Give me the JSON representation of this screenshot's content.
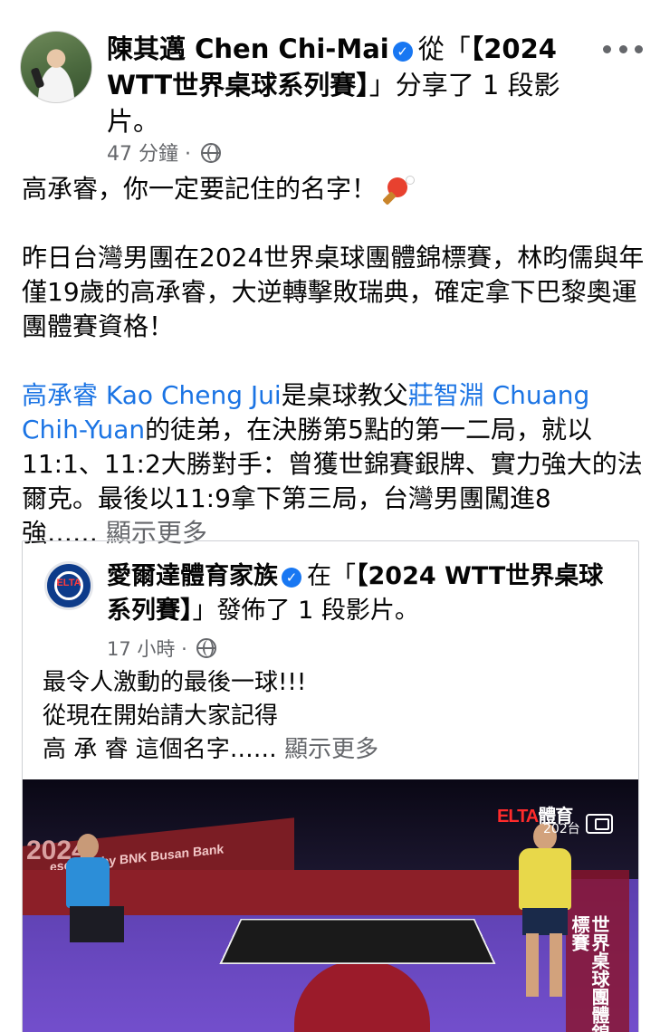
{
  "post": {
    "author": "陳其邁 Chen Chi-Mai",
    "action_prefix": "從「",
    "page_name": "【2024 WTT世界桌球系列賽】",
    "action_suffix": "」分享了 1 段影片。",
    "time": "47 分鐘",
    "privacy_icon": "globe-icon",
    "more_icon": "more-options-icon",
    "line1": "高承睿，你一定要記住的名字！",
    "paragraph2": "昨日台灣男團在2024世界桌球團體錦標賽，林昀儒與年僅19歲的高承睿，大逆轉擊敗瑞典，確定拿下巴黎奧運團體賽資格！",
    "p3_link1": "高承睿 Kao Cheng Jui",
    "p3_text1": "是桌球教父",
    "p3_link2": "莊智淵  Chuang Chih-Yuan",
    "p3_text2": "的徒弟，在決勝第5點的第一二局，就以11:1、11:2大勝對手：曾獲世錦賽銀牌、實力強大的法爾克。最後以11:9拿下第三局，台灣男團闖進8強……",
    "see_more": "顯示更多"
  },
  "shared": {
    "author": "愛爾達體育家族",
    "action_prefix": "在「",
    "page_name": "【2024 WTT世界桌球系列賽】",
    "action_suffix": "」發佈了 1 段影片。",
    "time": "17 小時",
    "avatar_text": "ELTA",
    "line1": "最令人激動的最後一球!!!",
    "line2": "從現在開始請大家記得",
    "line3": "高 承 睿 這個名字……",
    "see_more": "顯示更多"
  },
  "video": {
    "logo_main": "ELTA",
    "logo_suffix": "體育",
    "channel": "202台",
    "ad_ending": "esented by",
    "ad_bnk": "BNK",
    "ad_busan": "Busan Bank",
    "year_partial": "2024",
    "side_banner": "世界桌球團體錦標賽",
    "pip_icon": "picture-in-picture-icon"
  },
  "colors": {
    "link": "#1b74e4",
    "meta": "#65676b",
    "verified": "#1877f2"
  }
}
